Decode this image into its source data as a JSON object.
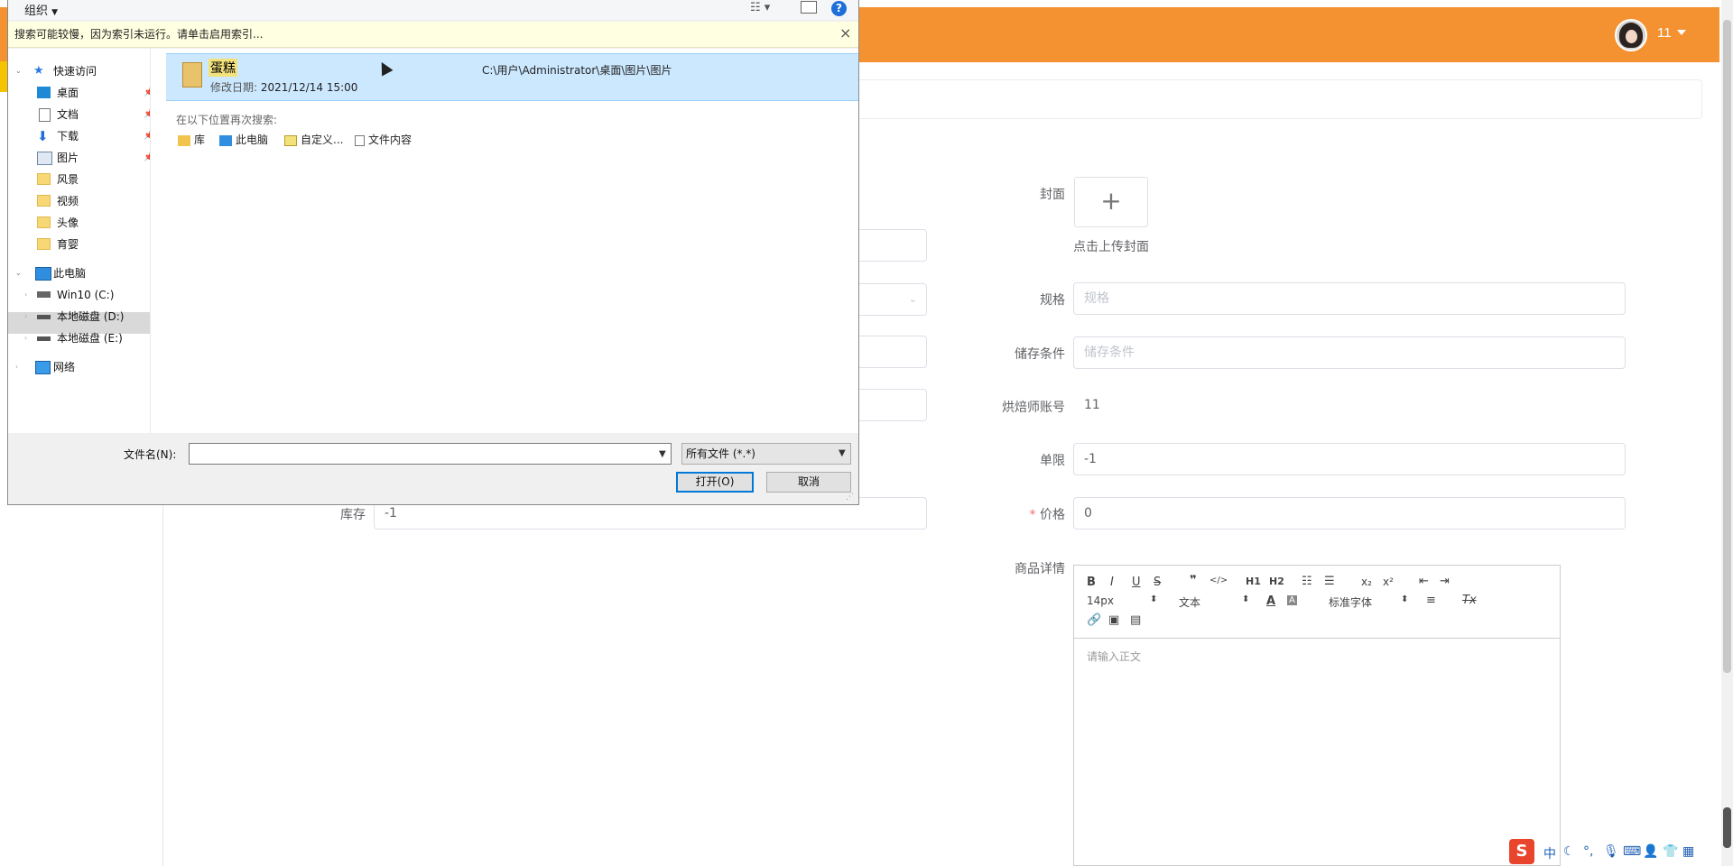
{
  "app": {
    "user_name": "11",
    "colors": {
      "accent": "#f49231",
      "primary": "#0078d7",
      "required": "#f56c6c"
    }
  },
  "form": {
    "cover_label": "封面",
    "upload_plus": "+",
    "upload_text": "点击上传封面",
    "spec_label": "规格",
    "spec_placeholder": "规格",
    "storage_label": "储存条件",
    "storage_placeholder": "储存条件",
    "baker_label": "烘焙师账号",
    "baker_value": "11",
    "limit_label": "单限",
    "limit_value": "-1",
    "price_required": "*",
    "price_label": "价格",
    "price_value": "0",
    "stock_label": "库存",
    "stock_value": "-1",
    "detail_label": "商品详情"
  },
  "editor": {
    "font_size": "14px",
    "block_type": "文本",
    "font_family": "标准字体",
    "placeholder": "请输入正文",
    "buttons": [
      "B",
      "I",
      "U",
      "S",
      "❞",
      "</>",
      "H1",
      "H2",
      "ol",
      "ul",
      "x₂",
      "x²",
      "outdent",
      "indent",
      "A",
      "A-bg",
      "align",
      "Tx",
      "link",
      "image",
      "video"
    ]
  },
  "dialog": {
    "organize": "组织",
    "info_bar": "搜索可能较慢，因为索引未运行。请单击启用索引...",
    "info_close": "×",
    "nav": {
      "quick_access": "快速访问",
      "items": [
        {
          "label": "桌面",
          "pinned": true
        },
        {
          "label": "文档",
          "pinned": true
        },
        {
          "label": "下载",
          "pinned": true
        },
        {
          "label": "图片",
          "pinned": true
        },
        {
          "label": "风景",
          "pinned": false
        },
        {
          "label": "视频",
          "pinned": false
        },
        {
          "label": "头像",
          "pinned": false
        },
        {
          "label": "育婴",
          "pinned": false
        }
      ],
      "this_pc": "此电脑",
      "drives": [
        "Win10 (C:)",
        "本地磁盘 (D:)",
        "本地磁盘 (E:)"
      ],
      "network": "网络"
    },
    "result": {
      "name": "蛋糕",
      "date_label": "修改日期:",
      "date": "2021/12/14 15:00",
      "path": "C:\\用户\\Administrator\\桌面\\图片\\图片"
    },
    "search_again": "在以下位置再次搜索:",
    "search_locations": [
      "库",
      "此电脑",
      "自定义...",
      "文件内容"
    ],
    "filename_label": "文件名(N):",
    "filename_value": "",
    "filetype": "所有文件 (*.*)",
    "open_button": "打开(O)",
    "cancel_button": "取消"
  },
  "ime": [
    "中",
    "🌙",
    "°,",
    "🎤",
    "⌨",
    "👤",
    "👕",
    "▦"
  ]
}
